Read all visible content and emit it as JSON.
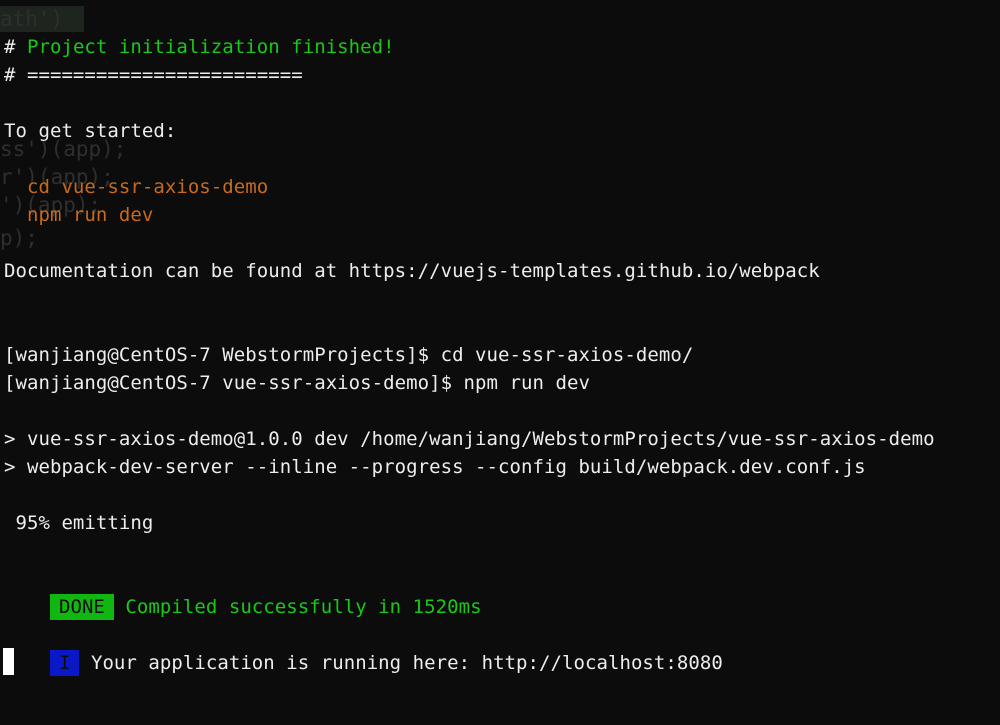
{
  "ghost": {
    "lines": [
      "ath')",
      "ss')(app);",
      "r')(app);",
      "')(app);",
      "p);"
    ]
  },
  "terminal": {
    "init_finished": "# Project initialization finished!",
    "separator": "# ========================",
    "get_started": "To get started:",
    "cmd_cd": "  cd vue-ssr-axios-demo",
    "cmd_npm": "  npm run dev",
    "docs": "Documentation can be found at https://vuejs-templates.github.io/webpack",
    "prompt1": "[wanjiang@CentOS-7 WebstormProjects]$ cd vue-ssr-axios-demo/",
    "prompt2": "[wanjiang@CentOS-7 vue-ssr-axios-demo]$ npm run dev",
    "script1": "> vue-ssr-axios-demo@1.0.0 dev /home/wanjiang/WebstormProjects/vue-ssr-axios-demo",
    "script2": "> webpack-dev-server --inline --progress --config build/webpack.dev.conf.js",
    "progress": " 95% emitting",
    "done_badge": "DONE",
    "done_message": " Compiled successfully in 1520ms",
    "info_badge": "I",
    "info_message": " Your application is running here: http://localhost:8080"
  },
  "colors": {
    "background": "#0c0c0c",
    "success": "#19c819",
    "command": "#c86a1c",
    "info_badge": "#0a18c8"
  }
}
